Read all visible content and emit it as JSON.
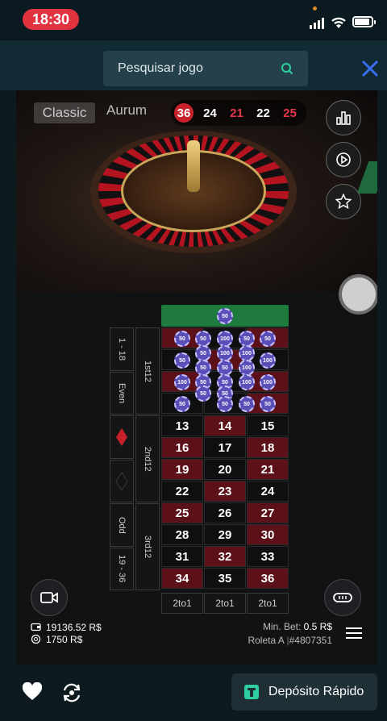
{
  "status_bar": {
    "time": "18:30"
  },
  "search": {
    "placeholder": "Pesquisar jogo"
  },
  "game": {
    "tabs": [
      "Classic",
      "Aurum"
    ],
    "recent_results": [
      {
        "value": "36",
        "color": "red"
      },
      {
        "value": "24",
        "color": "black"
      },
      {
        "value": "21",
        "color": "red"
      },
      {
        "value": "22",
        "color": "black"
      },
      {
        "value": "25",
        "color": "red"
      }
    ],
    "table": {
      "zero_chip": "50",
      "rows": [
        [
          {
            "n": "13",
            "c": "black"
          },
          {
            "n": "14",
            "c": "red"
          },
          {
            "n": "15",
            "c": "black"
          }
        ],
        [
          {
            "n": "16",
            "c": "red"
          },
          {
            "n": "17",
            "c": "black"
          },
          {
            "n": "18",
            "c": "red"
          }
        ],
        [
          {
            "n": "19",
            "c": "red"
          },
          {
            "n": "20",
            "c": "black"
          },
          {
            "n": "21",
            "c": "red"
          }
        ],
        [
          {
            "n": "22",
            "c": "black"
          },
          {
            "n": "23",
            "c": "red"
          },
          {
            "n": "24",
            "c": "black"
          }
        ],
        [
          {
            "n": "25",
            "c": "red"
          },
          {
            "n": "26",
            "c": "black"
          },
          {
            "n": "27",
            "c": "red"
          }
        ],
        [
          {
            "n": "28",
            "c": "black"
          },
          {
            "n": "29",
            "c": "black"
          },
          {
            "n": "30",
            "c": "red"
          }
        ],
        [
          {
            "n": "31",
            "c": "black"
          },
          {
            "n": "32",
            "c": "red"
          },
          {
            "n": "33",
            "c": "black"
          }
        ],
        [
          {
            "n": "34",
            "c": "red"
          },
          {
            "n": "35",
            "c": "black"
          },
          {
            "n": "36",
            "c": "red"
          }
        ]
      ],
      "dozens": [
        "1st12",
        "2nd12",
        "3rd12"
      ],
      "outside": {
        "low": "1 - 18",
        "even": "Even",
        "odd": "Odd",
        "high": "19 - 36"
      },
      "columns": [
        "2to1",
        "2to1",
        "2to1"
      ],
      "chips": [
        "50",
        "50",
        "100",
        "50",
        "50",
        "50",
        "50",
        "100",
        "100",
        "100",
        "50",
        "50",
        "100",
        "100",
        "50",
        "50",
        "100",
        "100",
        "50",
        "50",
        "50",
        "50",
        "50",
        "50"
      ]
    },
    "balance": "19136.52 R$",
    "total_bet": "1750 R$",
    "min_bet_label": "Min. Bet:",
    "min_bet_value": "0.5 R$",
    "table_name": "Roleta A",
    "table_id": "#4807351"
  },
  "bottom": {
    "deposit_label": "Depósito Rápido"
  },
  "colors": {
    "accent_green": "#2fd0a0",
    "close_blue": "#3a6ff0",
    "red": "#c6212b"
  }
}
